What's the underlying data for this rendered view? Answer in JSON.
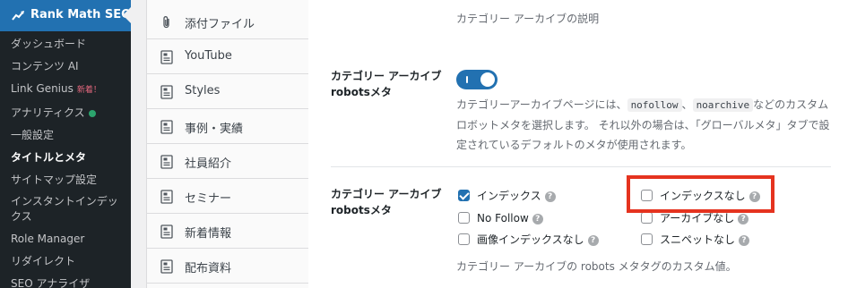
{
  "admin_menu": {
    "plugin_title": "Rank Math SEO",
    "items": [
      {
        "label": "ダッシュボード"
      },
      {
        "label": "コンテンツ AI"
      },
      {
        "label": "Link Genius",
        "badge": "新着！"
      },
      {
        "label": "アナリティクス",
        "status_color": "#2ca46d"
      },
      {
        "label": "一般設定"
      },
      {
        "label": "タイトルとメタ",
        "current": true
      },
      {
        "label": "サイトマップ設定"
      },
      {
        "label": "インスタントインデックス"
      },
      {
        "label": "Role Manager"
      },
      {
        "label": "リダイレクト"
      },
      {
        "label": "SEO アナライザ"
      }
    ]
  },
  "post_types": [
    {
      "label": "添付ファイル",
      "icon": "paperclip-icon"
    },
    {
      "label": "YouTube",
      "icon": "document-icon"
    },
    {
      "label": "Styles",
      "icon": "document-icon"
    },
    {
      "label": "事例・実績",
      "icon": "document-icon"
    },
    {
      "label": "社員紹介",
      "icon": "document-icon"
    },
    {
      "label": "セミナー",
      "icon": "document-icon"
    },
    {
      "label": "新着情報",
      "icon": "document-icon"
    },
    {
      "label": "配布資料",
      "icon": "document-icon"
    }
  ],
  "settings": {
    "prev_description": "カテゴリー アーカイブの説明",
    "custom_robots": {
      "label": "カテゴリー アーカイブrobotsメタ",
      "enabled": true,
      "desc_part1": "カテゴリーアーカイブページには、",
      "code1": "nofollow",
      "sep": "、",
      "code2": "noarchive",
      "desc_part2": "などのカスタムロボットメタを選択します。 それ以外の場合は、「グローバルメタ」タブで設定されているデフォルトのメタが使用されます。"
    },
    "robots_meta": {
      "label": "カテゴリー アーカイブrobotsメタ",
      "options": [
        {
          "label": "インデックス",
          "checked": true
        },
        {
          "label": "インデックスなし",
          "checked": false
        },
        {
          "label": "No Follow",
          "checked": false
        },
        {
          "label": "アーカイブなし",
          "checked": false
        },
        {
          "label": "画像インデックスなし",
          "checked": false
        },
        {
          "label": "スニペットなし",
          "checked": false
        }
      ],
      "help_glyph": "?",
      "description": "カテゴリー アーカイブの robots メタタグのカスタム値。"
    }
  },
  "colors": {
    "accent": "#2271b1",
    "highlight": "#e5331f",
    "sidebar_bg": "#1d2327"
  }
}
